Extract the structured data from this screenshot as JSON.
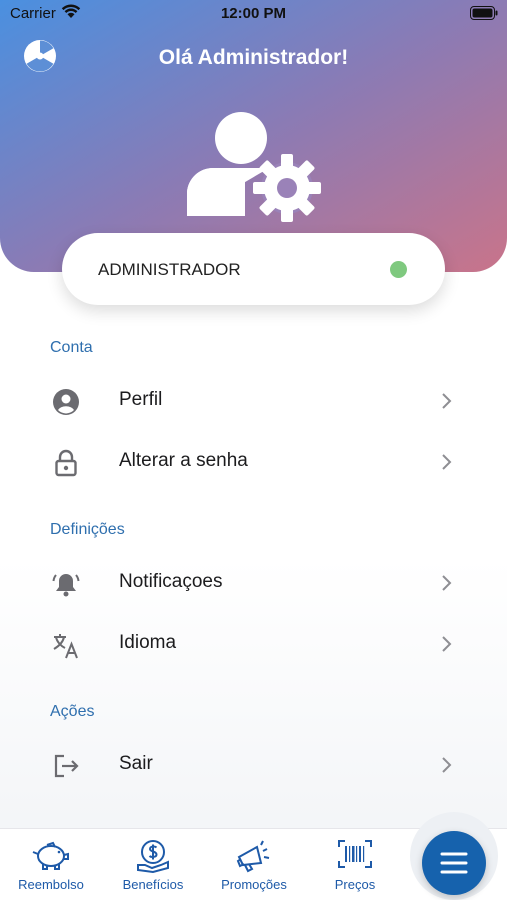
{
  "status_bar": {
    "carrier": "Carrier",
    "time": "12:00 PM"
  },
  "header": {
    "greeting": "Olá Administrador!"
  },
  "role_card": {
    "role": "ADMINISTRADOR",
    "status_color": "#7fc97f"
  },
  "sections": {
    "conta": "Conta",
    "definicoes": "Definições",
    "acoes": "Ações"
  },
  "menu": {
    "perfil": "Perfil",
    "alterar_senha": "Alterar a senha",
    "notificacoes": "Notificaçoes",
    "idioma": "Idioma",
    "sair": "Sair"
  },
  "tabbar": {
    "reembolso": "Reembolso",
    "beneficios": "Benefícios",
    "promocoes": "Promoções",
    "precos": "Preços"
  },
  "colors": {
    "accent": "#1662ad",
    "section_title": "#2f6fae",
    "header_start": "#4a90e0",
    "header_end": "#c9748a"
  }
}
